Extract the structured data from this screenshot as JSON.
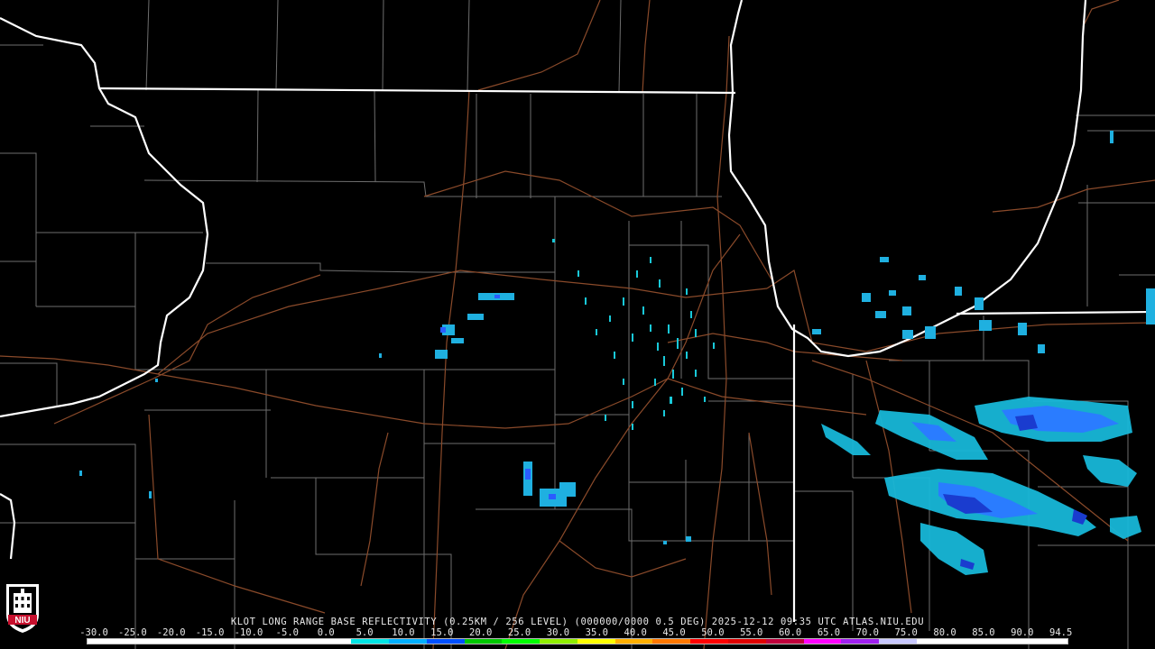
{
  "radar": {
    "caption": "KLOT LONG RANGE BASE REFLECTIVITY (0.25KM / 256 LEVEL) (000000/0000 0.5 DEG) 2025-12-12 09:35 UTC  ATLAS.NIU.EDU",
    "scale_labels": [
      "-30.0",
      "-25.0",
      "-20.0",
      "-15.0",
      "-10.0",
      "-5.0",
      "0.0",
      "5.0",
      "10.0",
      "15.0",
      "20.0",
      "25.0",
      "30.0",
      "35.0",
      "40.0",
      "45.0",
      "50.0",
      "55.0",
      "60.0",
      "65.0",
      "70.0",
      "75.0",
      "80.0",
      "85.0",
      "90.0",
      "94.5"
    ],
    "scale_colors": [
      "#ffffff",
      "#ffffff",
      "#ffffff",
      "#ffffff",
      "#ffffff",
      "#ffffff",
      "#ffffff",
      "#00e5e5",
      "#00b0ff",
      "#0050ff",
      "#00c800",
      "#00ff00",
      "#90ee00",
      "#ffff00",
      "#ffb000",
      "#ff7800",
      "#ff0000",
      "#e00000",
      "#c0003c",
      "#ff00ff",
      "#a020f0",
      "#c8c8ff",
      "#ffffff",
      "#ffffff",
      "#ffffff",
      "#ffffff"
    ]
  },
  "logo": {
    "text": "NIU",
    "color": "#c8102e"
  }
}
